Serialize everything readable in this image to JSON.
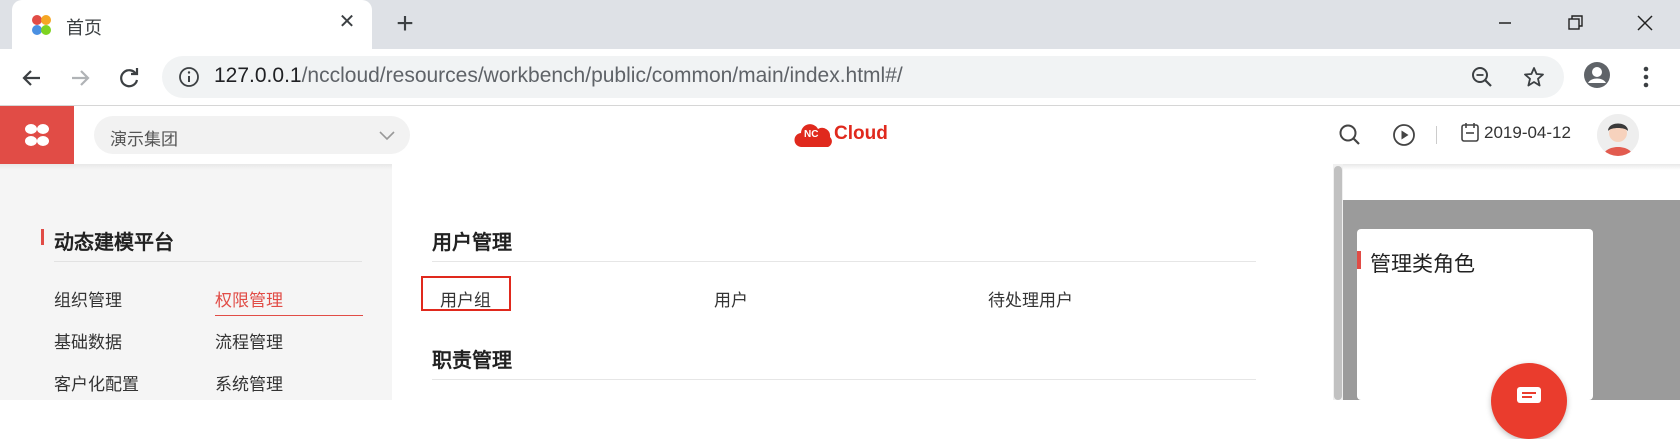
{
  "browser": {
    "tab_title": "首页",
    "tab_close": "✕",
    "new_tab": "+",
    "url_host": "127.0.0.1",
    "url_path": "/nccloud/resources/workbench/public/common/main/index.html#/"
  },
  "header": {
    "group_select_value": "演示集团",
    "brand_badge": "NC",
    "brand_word": "Cloud",
    "date": "2019-04-12"
  },
  "left_panel": {
    "title": "动态建模平台",
    "items": [
      {
        "label": "组织管理",
        "active": false
      },
      {
        "label": "权限管理",
        "active": true
      },
      {
        "label": "基础数据",
        "active": false
      },
      {
        "label": "流程管理",
        "active": false
      },
      {
        "label": "客户化配置",
        "active": false
      },
      {
        "label": "系统管理",
        "active": false
      }
    ]
  },
  "main_panel": {
    "sections": [
      {
        "title": "用户管理",
        "items": [
          "用户组",
          "用户",
          "待处理用户"
        ]
      },
      {
        "title": "职责管理",
        "items": []
      }
    ]
  },
  "right_panel": {
    "card_title": "管理类角色"
  },
  "colors": {
    "accent": "#e14c46",
    "brand_red": "#e0291d",
    "highlight_box": "#e0291d"
  }
}
